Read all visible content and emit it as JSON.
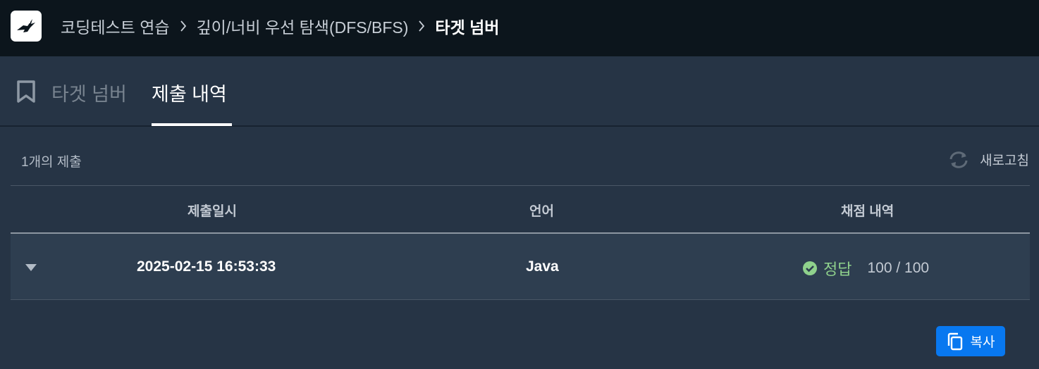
{
  "header": {
    "logo": "bird-logo-icon",
    "breadcrumbs": [
      "코딩테스트 연습",
      "깊이/너비 우선 탐색(DFS/BFS)",
      "타겟 넘버"
    ]
  },
  "tabs": [
    {
      "label": "타겟 넘버",
      "icon": "bookmark-icon",
      "active": false
    },
    {
      "label": "제출 내역",
      "active": true
    }
  ],
  "submissions": {
    "count_label": "1개의 제출",
    "refresh_label": "새로고침",
    "columns": [
      "제출일시",
      "언어",
      "채점 내역"
    ],
    "rows": [
      {
        "datetime": "2025-02-15 16:53:33",
        "language": "Java",
        "verdict": "정답",
        "score": "100 / 100"
      }
    ]
  },
  "actions": {
    "copy_label": "복사"
  },
  "colors": {
    "accent": "#0878f0",
    "success": "#8fd18c",
    "topbar": "#0c151c",
    "background": "#263445"
  }
}
